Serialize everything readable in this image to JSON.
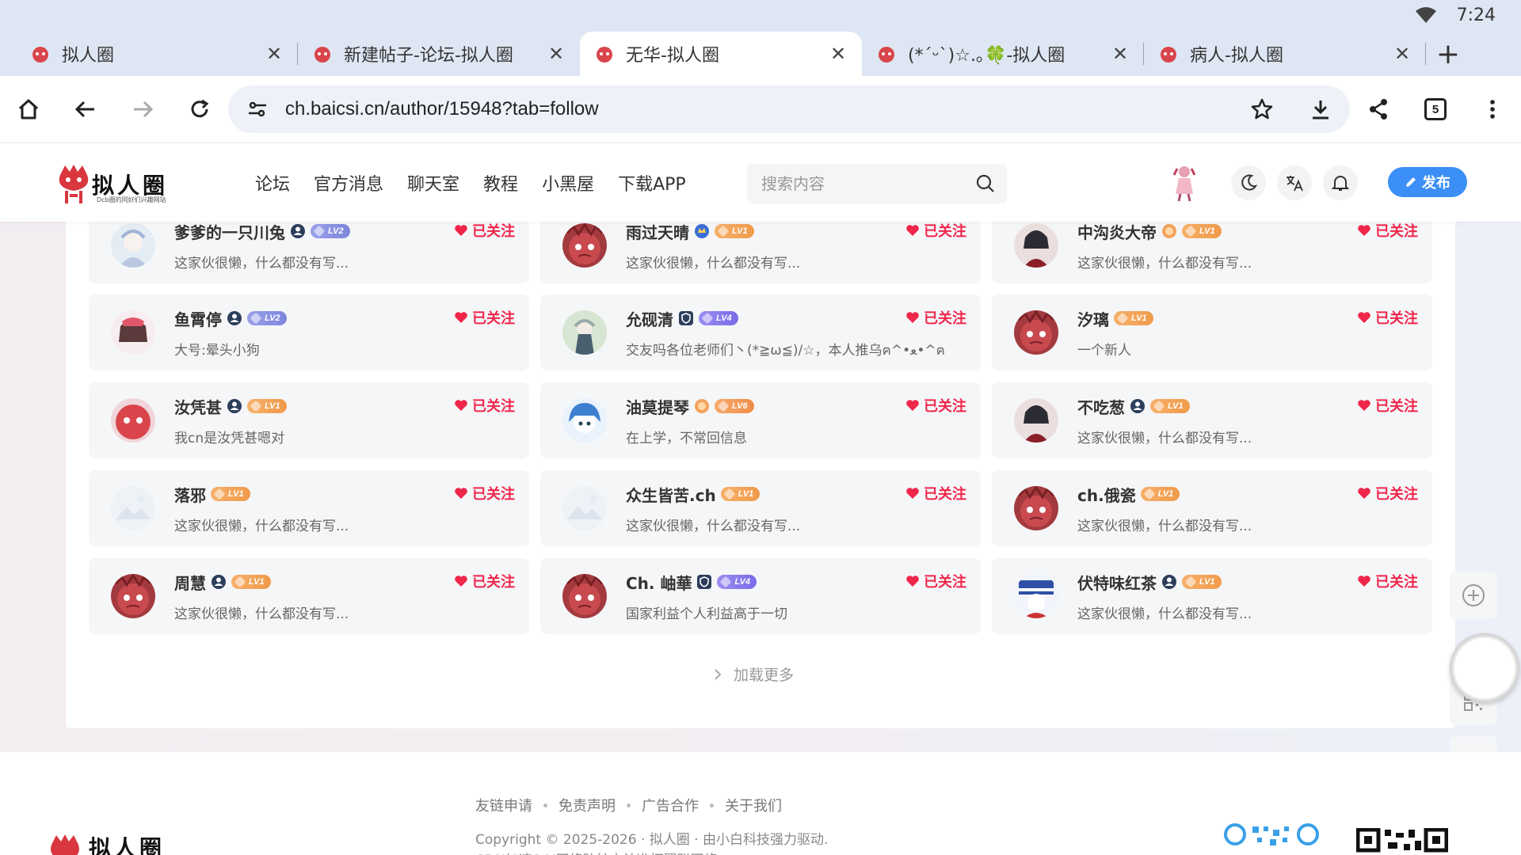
{
  "status_bar": {
    "time": "7:24"
  },
  "browser": {
    "tabs": [
      {
        "title": "拟人圈"
      },
      {
        "title": "新建帖子-论坛-拟人圈"
      },
      {
        "title": "无华-拟人圈"
      },
      {
        "title": "(*´ᵕ`)☆.｡🍀-拟人圈"
      },
      {
        "title": "病人-拟人圈"
      }
    ],
    "active_tab_index": 2,
    "url": "ch.baicsi.cn/author/15948?tab=follow",
    "tab_count": "5",
    "tab_close_glyph": "✕",
    "new_tab_glyph": "+"
  },
  "site": {
    "logo_text": "拟人圈",
    "logo_subtitle": "Dcb圈的同好们兴趣网站",
    "nav": [
      "论坛",
      "官方消息",
      "聊天室",
      "教程",
      "小黑屋",
      "下载APP"
    ],
    "search_placeholder": "搜索内容",
    "publish_label": "发布",
    "accent_color": "#3b8ff6",
    "follow_color": "#f0264b"
  },
  "follow_list": {
    "followed_label": "已关注",
    "users": [
      {
        "name": "爹爹的一只川兔",
        "badge": "verified",
        "level": "LV2",
        "bio": "这家伙很懒，什么都没有写...",
        "avatar": "anime-white"
      },
      {
        "name": "雨过天晴",
        "badge": "vip",
        "level": "LV1",
        "bio": "这家伙很懒，什么都没有写...",
        "avatar": "mascot"
      },
      {
        "name": "中沟炎大帝",
        "badge": "gold",
        "level": "LV1",
        "bio": "这家伙很懒，什么都没有写...",
        "avatar": "anime-dark"
      },
      {
        "name": "鱼霄停",
        "badge": "verified",
        "level": "LV2",
        "bio": "大号:晕头小狗",
        "avatar": "anime-girl"
      },
      {
        "name": "允砚清",
        "badge": "shield",
        "level": "LV4",
        "bio": "交友吗各位老师们丶(*≧ω≦)/☆，本人推乌ฅ^•ﻌ•^ฅ",
        "avatar": "anime-green"
      },
      {
        "name": "汐璃",
        "badge": "",
        "level": "LV1",
        "bio": "一个新人",
        "avatar": "mascot"
      },
      {
        "name": "汝凭甚",
        "badge": "verified",
        "level": "LV1",
        "bio": "我cn是汝凭甚嗯对",
        "avatar": "mascot-pink"
      },
      {
        "name": "油莫提琴",
        "badge": "gold",
        "level": "LV6",
        "bio": "在上学，不常回信息",
        "avatar": "anime-blue"
      },
      {
        "name": "不吃葱",
        "badge": "verified",
        "level": "LV1",
        "bio": "这家伙很懒，什么都没有写...",
        "avatar": "anime-dark"
      },
      {
        "name": "落邪",
        "badge": "",
        "level": "LV1",
        "bio": "这家伙很懒，什么都没有写...",
        "avatar": "placeholder"
      },
      {
        "name": "众生皆苦.ch",
        "badge": "",
        "level": "LV1",
        "bio": "这家伙很懒，什么都没有写...",
        "avatar": "placeholder"
      },
      {
        "name": "ch.俄瓷",
        "badge": "",
        "level": "LV1",
        "bio": "这家伙很懒，什么都没有写...",
        "avatar": "mascot"
      },
      {
        "name": "周慧",
        "badge": "verified",
        "level": "LV1",
        "bio": "这家伙很懒，什么都没有写...",
        "avatar": "mascot"
      },
      {
        "name": "Ch. 岫華",
        "badge": "shield",
        "level": "LV4",
        "bio": "国家利益个人利益高于一切",
        "avatar": "mascot"
      },
      {
        "name": "伏特味红茶",
        "badge": "verified",
        "level": "LV1",
        "bio": "这家伙很懒，什么都没有写...",
        "avatar": "anime-flag"
      }
    ],
    "load_more": "加载更多"
  },
  "footer": {
    "links": [
      "友链申请",
      "免责声明",
      "广告合作",
      "关于我们"
    ],
    "copyright": "Copyright © 2025-2026 · 拟人圈 · 由小白科技强力驱动.",
    "cdn": "CDN加速&AI网络防护由认准拓翼联网络"
  }
}
